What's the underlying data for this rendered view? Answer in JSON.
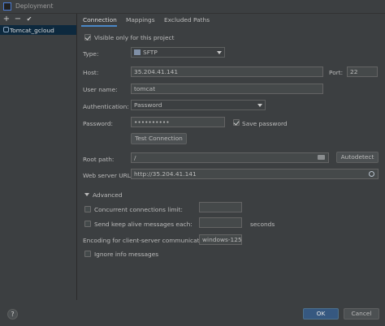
{
  "window": {
    "title": "Deployment"
  },
  "toolbar": {
    "add": "+",
    "remove": "−",
    "apply": "✔"
  },
  "servers": [
    {
      "name": "Tomcat_gcloud",
      "selected": true
    }
  ],
  "tabs": [
    {
      "label": "Connection",
      "active": true
    },
    {
      "label": "Mappings",
      "active": false
    },
    {
      "label": "Excluded Paths",
      "active": false
    }
  ],
  "connection": {
    "visible_only_label": "Visible only for this project",
    "visible_only_checked": true,
    "type_label": "Type:",
    "type_value": "SFTP",
    "host_label": "Host:",
    "host_value": "35.204.41.141",
    "port_label": "Port:",
    "port_value": "22",
    "username_label": "User name:",
    "username_value": "tomcat",
    "auth_label": "Authentication:",
    "auth_value": "Password",
    "password_label": "Password:",
    "password_value": "••••••••••",
    "save_password_label": "Save password",
    "save_password_checked": true,
    "test_button": "Test Connection",
    "root_label": "Root path:",
    "root_value": "/",
    "autodetect_button": "Autodetect",
    "web_url_label": "Web server URL:",
    "web_url_value": "http://35.204.41.141"
  },
  "advanced": {
    "header": "Advanced",
    "concurrent_label": "Concurrent connections limit:",
    "concurrent_value": "",
    "keepalive_label": "Send keep alive messages each:",
    "keepalive_value": "",
    "seconds_label": "seconds",
    "encoding_label": "Encoding for client-server communication:",
    "encoding_value": "windows-1251",
    "ignore_info_label": "Ignore info messages"
  },
  "footer": {
    "help": "?",
    "ok": "OK",
    "cancel": "Cancel"
  },
  "colors": {
    "background": "#3c3f41",
    "accent": "#4a88c7",
    "selection": "#0d293e",
    "primary_button": "#365880"
  }
}
